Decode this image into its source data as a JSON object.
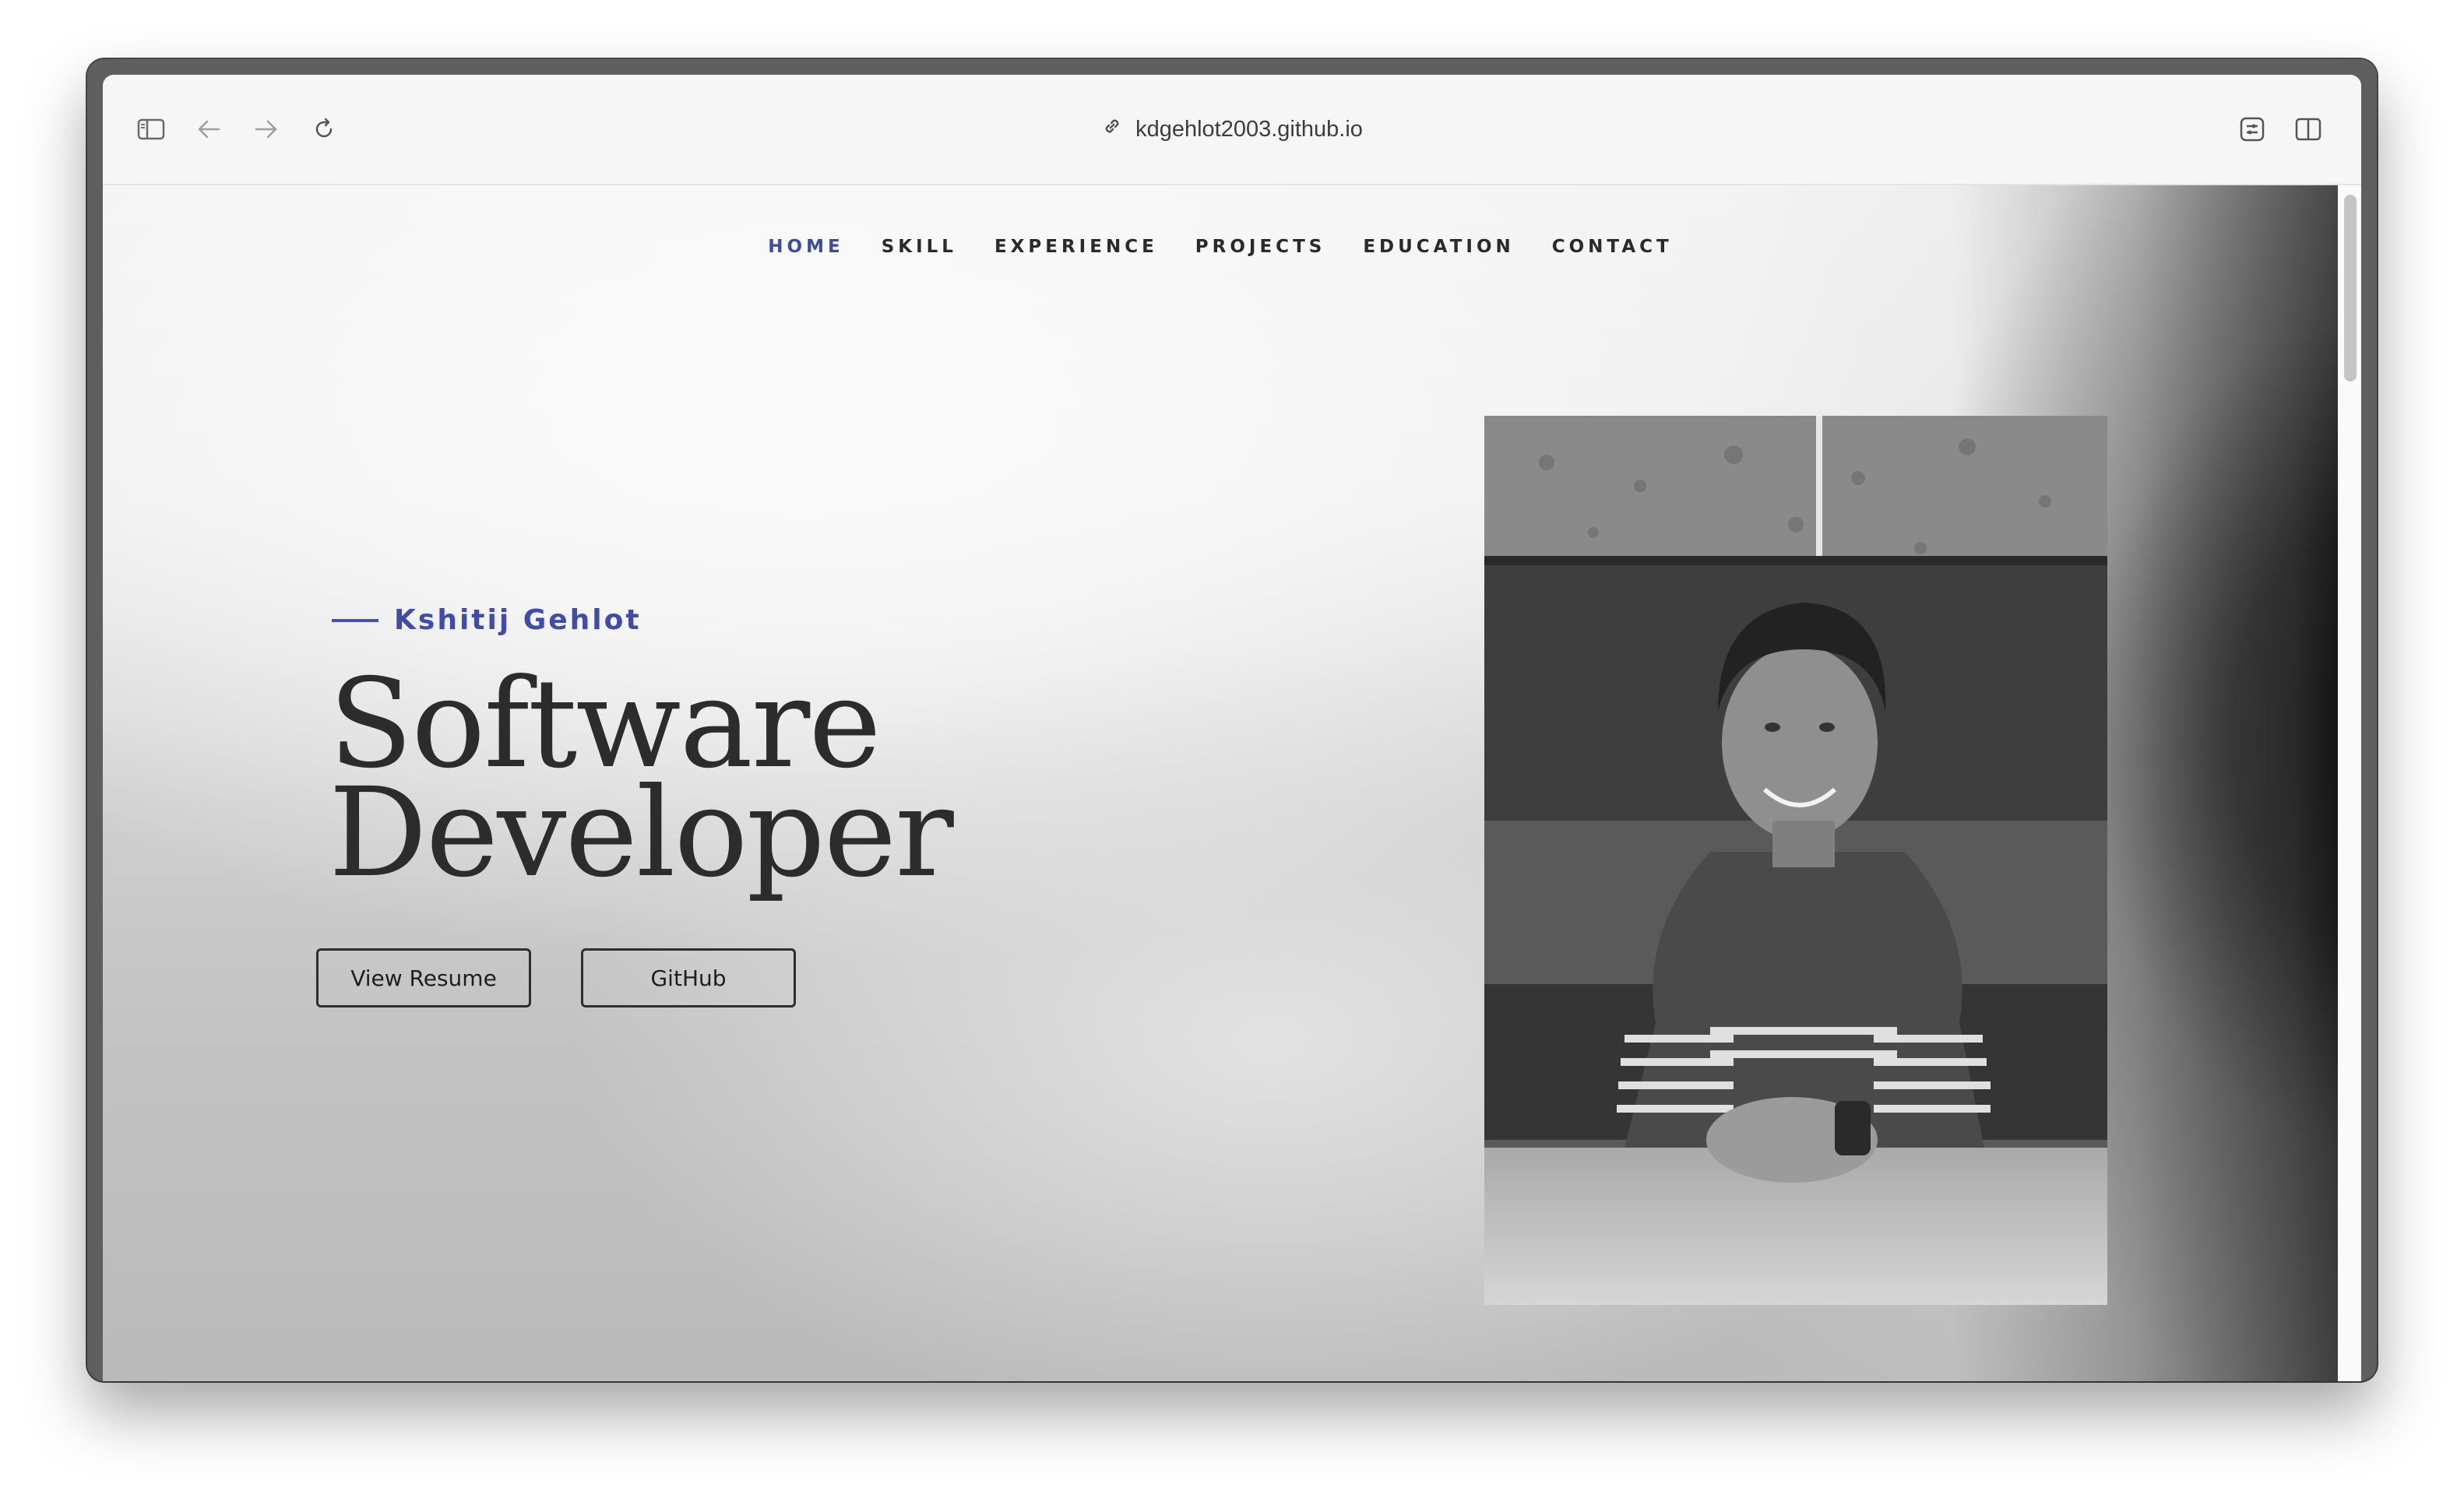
{
  "browser": {
    "url": "kdgehlot2003.github.io"
  },
  "nav": {
    "items": [
      "HOME",
      "SKILL",
      "EXPERIENCE",
      "PROJECTS",
      "EDUCATION",
      "CONTACT"
    ],
    "active": "HOME"
  },
  "hero": {
    "name": "Kshitij Gehlot",
    "title_line1": "Software",
    "title_line2": "Developer",
    "buttons": {
      "resume": "View Resume",
      "github": "GitHub"
    }
  },
  "colors": {
    "accent": "#3f4cae",
    "text": "#2c2c2c"
  }
}
